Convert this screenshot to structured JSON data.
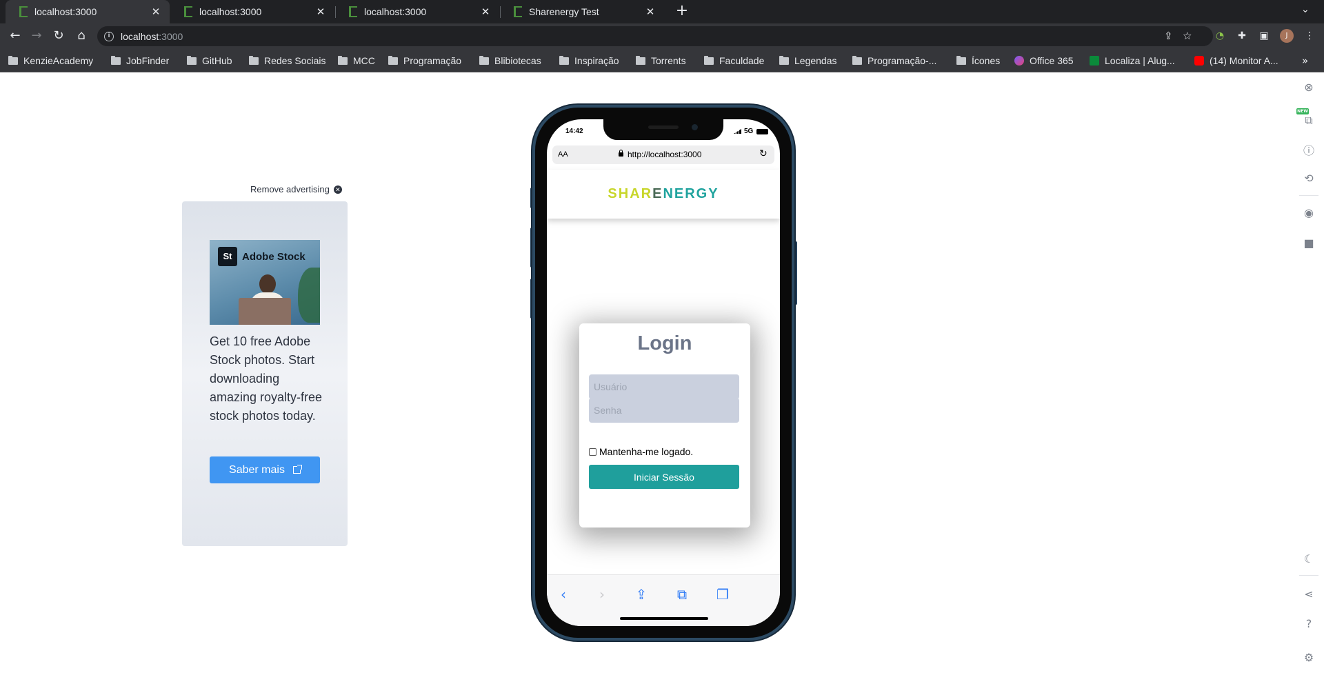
{
  "browser": {
    "tabs": [
      {
        "title": "localhost:3000",
        "active": true
      },
      {
        "title": "localhost:3000",
        "active": false
      },
      {
        "title": "localhost:3000",
        "active": false
      },
      {
        "title": "Sharenergy Test",
        "active": false
      }
    ],
    "new_tab_icon": "plus-icon",
    "address": {
      "host": "localhost",
      "port": ":3000"
    },
    "profile_initial": "J",
    "bookmarks": [
      {
        "label": "KenzieAcademy",
        "type": "folder"
      },
      {
        "label": "JobFinder",
        "type": "folder"
      },
      {
        "label": "GitHub",
        "type": "folder"
      },
      {
        "label": "Redes Sociais",
        "type": "folder"
      },
      {
        "label": "MCC",
        "type": "folder"
      },
      {
        "label": "Programação",
        "type": "folder"
      },
      {
        "label": "Blibiotecas",
        "type": "folder"
      },
      {
        "label": "Inspiração",
        "type": "folder"
      },
      {
        "label": "Torrents",
        "type": "folder"
      },
      {
        "label": "Faculdade",
        "type": "folder"
      },
      {
        "label": "Legendas",
        "type": "folder"
      },
      {
        "label": "Programação-...",
        "type": "folder"
      },
      {
        "label": "Ícones",
        "type": "folder"
      },
      {
        "label": "Office 365",
        "type": "site"
      },
      {
        "label": "Localiza | Alug...",
        "type": "site"
      },
      {
        "label": "(14) Monitor A...",
        "type": "site"
      }
    ]
  },
  "ad": {
    "remove_label": "Remove advertising",
    "brand_badge": "St",
    "brand_name": "Adobe Stock",
    "text": "Get 10 free Adobe Stock photos. Start downloading amazing royalty-free stock photos today.",
    "button_label": "Saber mais"
  },
  "phone": {
    "status_time": "14:42",
    "network": "5G",
    "safari_aa": "AA",
    "safari_url": "http://localhost:3000",
    "logo": {
      "part1": "SHAR",
      "part2": "E",
      "part3": "NERGY"
    },
    "login": {
      "title": "Login",
      "username_placeholder": "Usuário",
      "password_placeholder": "Senha",
      "remember_label": "Mantenha-me logado.",
      "submit_label": "Iniciar Sessão"
    }
  },
  "rail": {
    "new_badge": "NEW"
  },
  "colors": {
    "accent_teal": "#1f9f9c",
    "logo_yellow": "#c8d62b",
    "ad_button": "#4096f2",
    "chrome_dark": "#202124"
  }
}
